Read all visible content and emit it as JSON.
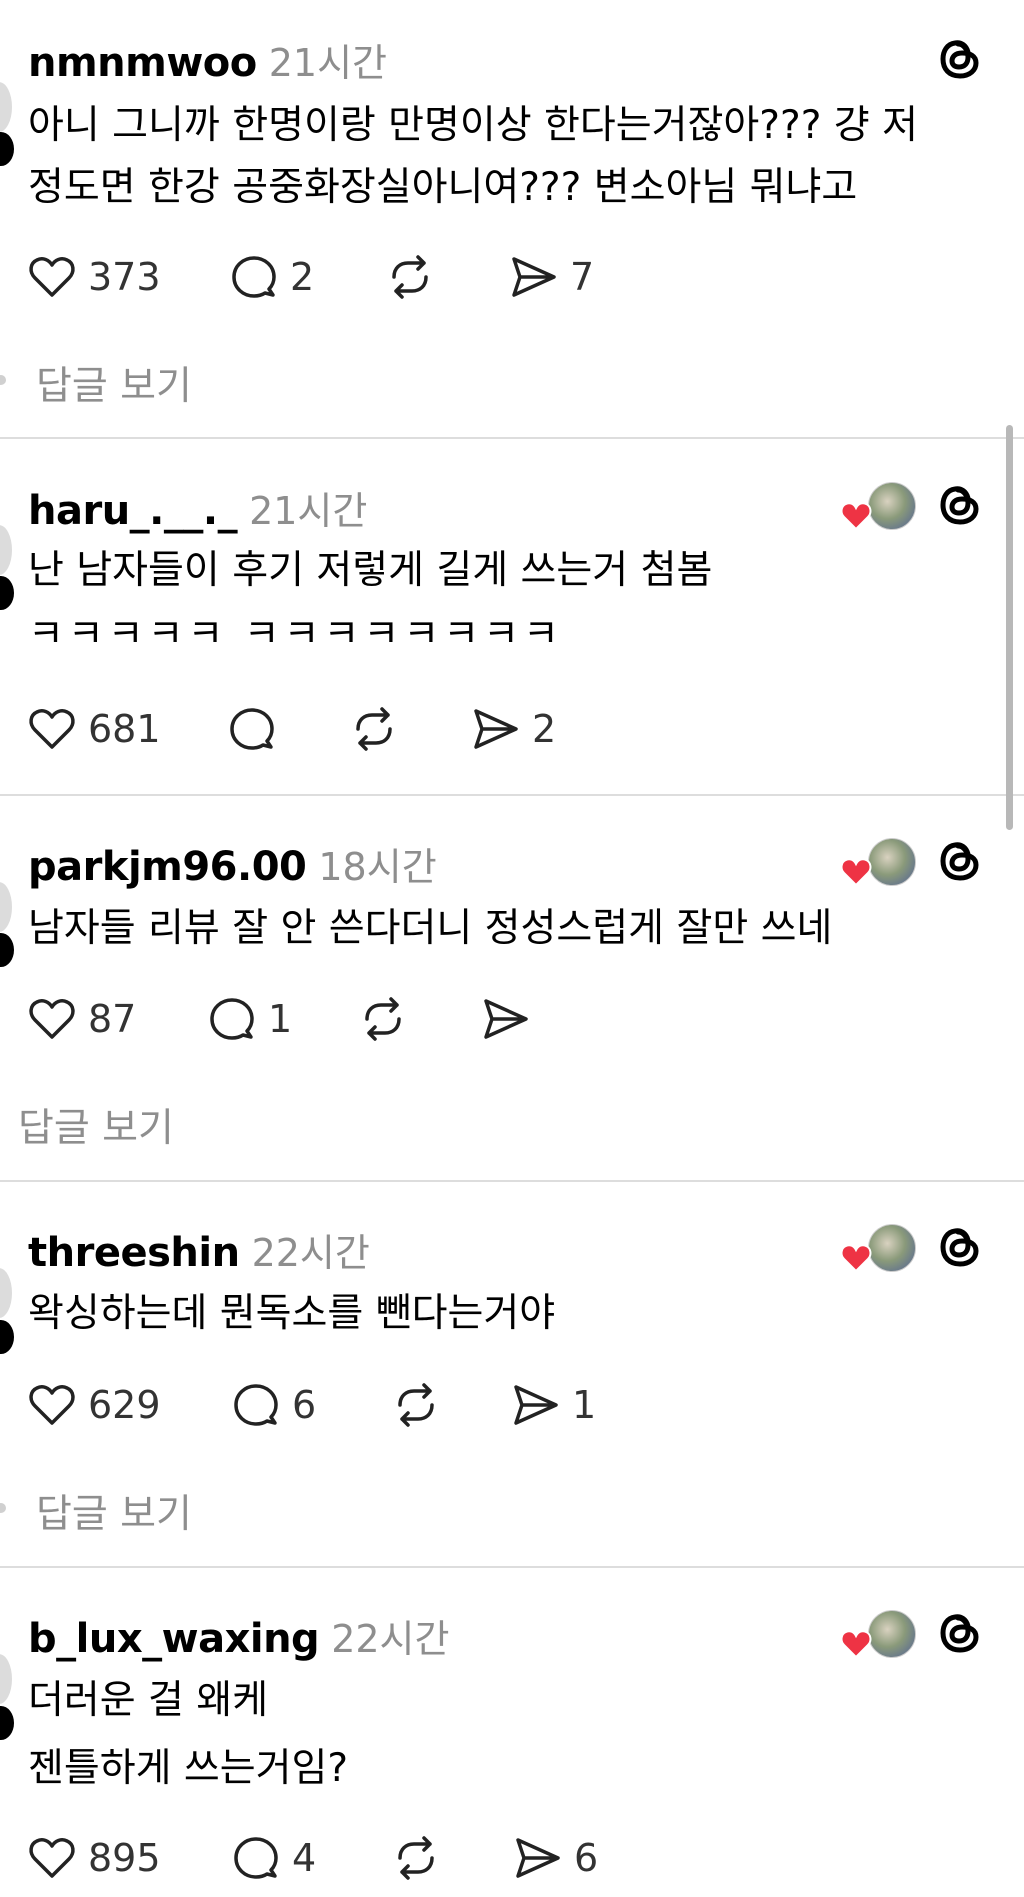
{
  "posts": [
    {
      "username": "nmnmwoo",
      "time": "21시간",
      "lines": [
        "아니 그니까 한명이랑 만명이상 한다는거잖아??? 걍 저",
        "정도면 한강 공중화장실아니여??? 변소아님 뭐냐고"
      ],
      "likes": "373",
      "comments": "2",
      "shares": "7",
      "view_replies": "답글 보기",
      "liked_by_author": false
    },
    {
      "username": "haru_.__._",
      "time": "21시간",
      "lines": [
        "난 남자들이 후기 저렇게 길게 쓰는거 첨봄",
        "ㅋㅋㅋㅋㅋ ㅋㅋㅋㅋㅋㅋㅋㅋ"
      ],
      "likes": "681",
      "comments": "",
      "shares": "2",
      "view_replies": "",
      "liked_by_author": true
    },
    {
      "username": "parkjm96.00",
      "time": "18시간",
      "lines": [
        "남자들 리뷰 잘 안 쓴다더니 정성스럽게 잘만 쓰네"
      ],
      "likes": "87",
      "comments": "1",
      "shares": "",
      "view_replies": "답글 보기",
      "liked_by_author": true
    },
    {
      "username": "threeshin",
      "time": "22시간",
      "lines": [
        "왁싱하는데 뭔독소를 뺀다는거야"
      ],
      "likes": "629",
      "comments": "6",
      "shares": "1",
      "view_replies": "답글 보기",
      "liked_by_author": true
    },
    {
      "username": "b_lux_waxing",
      "time": "22시간",
      "lines": [
        "더러운 걸 왜케",
        "젠틀하게 쓰는거임?"
      ],
      "likes": "895",
      "comments": "4",
      "shares": "6",
      "view_replies": "",
      "liked_by_author": true
    }
  ],
  "colors": {
    "heart_red": "#ee3344",
    "secondary_text": "#8e8e8e",
    "divider": "#dddddd"
  },
  "icons": {
    "like": "heart-outline-icon",
    "comment": "speech-bubble-icon",
    "repost": "repost-arrows-icon",
    "share": "paper-plane-icon",
    "app": "threads-logo-icon"
  }
}
